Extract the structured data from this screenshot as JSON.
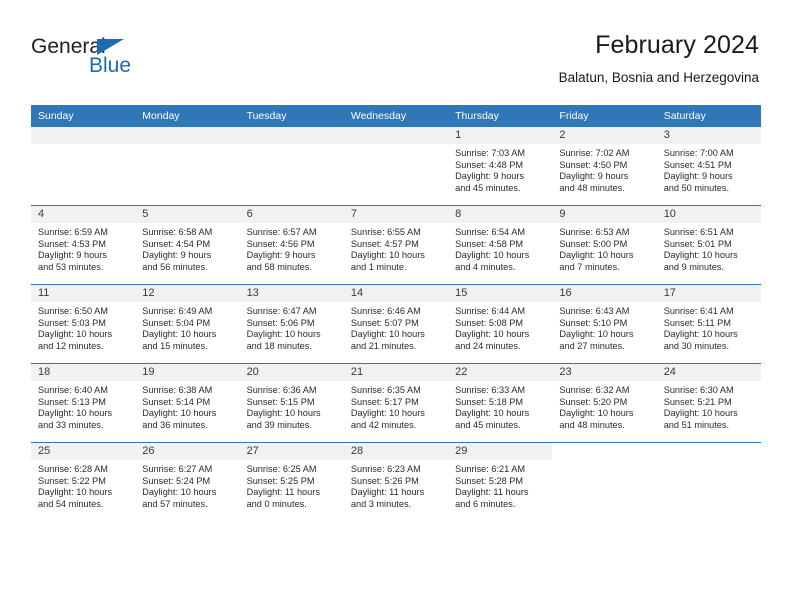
{
  "brand": {
    "name_part1": "General",
    "name_part2": "Blue",
    "flag_color": "#1b6cb3",
    "text_color": "#231f20"
  },
  "header": {
    "title": "February 2024",
    "location": "Balatun, Bosnia and Herzegovina"
  },
  "theme": {
    "header_blue": "#3077b8",
    "daynum_band": "#f1f1f1",
    "text": "#2b2b2b"
  },
  "weekdays": [
    "Sunday",
    "Monday",
    "Tuesday",
    "Wednesday",
    "Thursday",
    "Friday",
    "Saturday"
  ],
  "weeks": [
    [
      {
        "day": "",
        "sunrise": "",
        "sunset": "",
        "daylight1": "",
        "daylight2": ""
      },
      {
        "day": "",
        "sunrise": "",
        "sunset": "",
        "daylight1": "",
        "daylight2": ""
      },
      {
        "day": "",
        "sunrise": "",
        "sunset": "",
        "daylight1": "",
        "daylight2": ""
      },
      {
        "day": "",
        "sunrise": "",
        "sunset": "",
        "daylight1": "",
        "daylight2": ""
      },
      {
        "day": "1",
        "sunrise": "Sunrise: 7:03 AM",
        "sunset": "Sunset: 4:48 PM",
        "daylight1": "Daylight: 9 hours",
        "daylight2": "and 45 minutes."
      },
      {
        "day": "2",
        "sunrise": "Sunrise: 7:02 AM",
        "sunset": "Sunset: 4:50 PM",
        "daylight1": "Daylight: 9 hours",
        "daylight2": "and 48 minutes."
      },
      {
        "day": "3",
        "sunrise": "Sunrise: 7:00 AM",
        "sunset": "Sunset: 4:51 PM",
        "daylight1": "Daylight: 9 hours",
        "daylight2": "and 50 minutes."
      }
    ],
    [
      {
        "day": "4",
        "sunrise": "Sunrise: 6:59 AM",
        "sunset": "Sunset: 4:53 PM",
        "daylight1": "Daylight: 9 hours",
        "daylight2": "and 53 minutes."
      },
      {
        "day": "5",
        "sunrise": "Sunrise: 6:58 AM",
        "sunset": "Sunset: 4:54 PM",
        "daylight1": "Daylight: 9 hours",
        "daylight2": "and 56 minutes."
      },
      {
        "day": "6",
        "sunrise": "Sunrise: 6:57 AM",
        "sunset": "Sunset: 4:56 PM",
        "daylight1": "Daylight: 9 hours",
        "daylight2": "and 58 minutes."
      },
      {
        "day": "7",
        "sunrise": "Sunrise: 6:55 AM",
        "sunset": "Sunset: 4:57 PM",
        "daylight1": "Daylight: 10 hours",
        "daylight2": "and 1 minute."
      },
      {
        "day": "8",
        "sunrise": "Sunrise: 6:54 AM",
        "sunset": "Sunset: 4:58 PM",
        "daylight1": "Daylight: 10 hours",
        "daylight2": "and 4 minutes."
      },
      {
        "day": "9",
        "sunrise": "Sunrise: 6:53 AM",
        "sunset": "Sunset: 5:00 PM",
        "daylight1": "Daylight: 10 hours",
        "daylight2": "and 7 minutes."
      },
      {
        "day": "10",
        "sunrise": "Sunrise: 6:51 AM",
        "sunset": "Sunset: 5:01 PM",
        "daylight1": "Daylight: 10 hours",
        "daylight2": "and 9 minutes."
      }
    ],
    [
      {
        "day": "11",
        "sunrise": "Sunrise: 6:50 AM",
        "sunset": "Sunset: 5:03 PM",
        "daylight1": "Daylight: 10 hours",
        "daylight2": "and 12 minutes."
      },
      {
        "day": "12",
        "sunrise": "Sunrise: 6:49 AM",
        "sunset": "Sunset: 5:04 PM",
        "daylight1": "Daylight: 10 hours",
        "daylight2": "and 15 minutes."
      },
      {
        "day": "13",
        "sunrise": "Sunrise: 6:47 AM",
        "sunset": "Sunset: 5:06 PM",
        "daylight1": "Daylight: 10 hours",
        "daylight2": "and 18 minutes."
      },
      {
        "day": "14",
        "sunrise": "Sunrise: 6:46 AM",
        "sunset": "Sunset: 5:07 PM",
        "daylight1": "Daylight: 10 hours",
        "daylight2": "and 21 minutes."
      },
      {
        "day": "15",
        "sunrise": "Sunrise: 6:44 AM",
        "sunset": "Sunset: 5:08 PM",
        "daylight1": "Daylight: 10 hours",
        "daylight2": "and 24 minutes."
      },
      {
        "day": "16",
        "sunrise": "Sunrise: 6:43 AM",
        "sunset": "Sunset: 5:10 PM",
        "daylight1": "Daylight: 10 hours",
        "daylight2": "and 27 minutes."
      },
      {
        "day": "17",
        "sunrise": "Sunrise: 6:41 AM",
        "sunset": "Sunset: 5:11 PM",
        "daylight1": "Daylight: 10 hours",
        "daylight2": "and 30 minutes."
      }
    ],
    [
      {
        "day": "18",
        "sunrise": "Sunrise: 6:40 AM",
        "sunset": "Sunset: 5:13 PM",
        "daylight1": "Daylight: 10 hours",
        "daylight2": "and 33 minutes."
      },
      {
        "day": "19",
        "sunrise": "Sunrise: 6:38 AM",
        "sunset": "Sunset: 5:14 PM",
        "daylight1": "Daylight: 10 hours",
        "daylight2": "and 36 minutes."
      },
      {
        "day": "20",
        "sunrise": "Sunrise: 6:36 AM",
        "sunset": "Sunset: 5:15 PM",
        "daylight1": "Daylight: 10 hours",
        "daylight2": "and 39 minutes."
      },
      {
        "day": "21",
        "sunrise": "Sunrise: 6:35 AM",
        "sunset": "Sunset: 5:17 PM",
        "daylight1": "Daylight: 10 hours",
        "daylight2": "and 42 minutes."
      },
      {
        "day": "22",
        "sunrise": "Sunrise: 6:33 AM",
        "sunset": "Sunset: 5:18 PM",
        "daylight1": "Daylight: 10 hours",
        "daylight2": "and 45 minutes."
      },
      {
        "day": "23",
        "sunrise": "Sunrise: 6:32 AM",
        "sunset": "Sunset: 5:20 PM",
        "daylight1": "Daylight: 10 hours",
        "daylight2": "and 48 minutes."
      },
      {
        "day": "24",
        "sunrise": "Sunrise: 6:30 AM",
        "sunset": "Sunset: 5:21 PM",
        "daylight1": "Daylight: 10 hours",
        "daylight2": "and 51 minutes."
      }
    ],
    [
      {
        "day": "25",
        "sunrise": "Sunrise: 6:28 AM",
        "sunset": "Sunset: 5:22 PM",
        "daylight1": "Daylight: 10 hours",
        "daylight2": "and 54 minutes."
      },
      {
        "day": "26",
        "sunrise": "Sunrise: 6:27 AM",
        "sunset": "Sunset: 5:24 PM",
        "daylight1": "Daylight: 10 hours",
        "daylight2": "and 57 minutes."
      },
      {
        "day": "27",
        "sunrise": "Sunrise: 6:25 AM",
        "sunset": "Sunset: 5:25 PM",
        "daylight1": "Daylight: 11 hours",
        "daylight2": "and 0 minutes."
      },
      {
        "day": "28",
        "sunrise": "Sunrise: 6:23 AM",
        "sunset": "Sunset: 5:26 PM",
        "daylight1": "Daylight: 11 hours",
        "daylight2": "and 3 minutes."
      },
      {
        "day": "29",
        "sunrise": "Sunrise: 6:21 AM",
        "sunset": "Sunset: 5:28 PM",
        "daylight1": "Daylight: 11 hours",
        "daylight2": "and 6 minutes."
      },
      {
        "day": "",
        "sunrise": "",
        "sunset": "",
        "daylight1": "",
        "daylight2": ""
      },
      {
        "day": "",
        "sunrise": "",
        "sunset": "",
        "daylight1": "",
        "daylight2": ""
      }
    ]
  ]
}
